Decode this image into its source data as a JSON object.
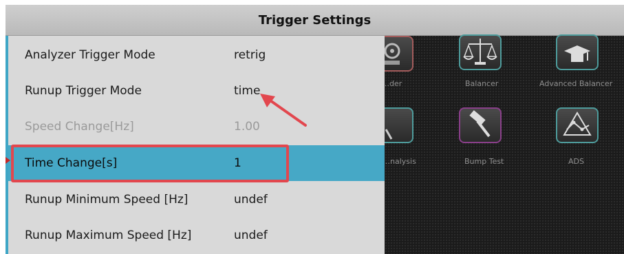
{
  "window": {
    "title": "Trigger Settings"
  },
  "settings": [
    {
      "label": "Analyzer Trigger Mode",
      "value": "retrig",
      "state": "normal"
    },
    {
      "label": "Runup Trigger Mode",
      "value": "time",
      "state": "normal"
    },
    {
      "label": "Speed Change[Hz]",
      "value": "1.00",
      "state": "disabled"
    },
    {
      "label": "Time Change[s]",
      "value": "1",
      "state": "selected"
    },
    {
      "label": "Runup Minimum Speed [Hz]",
      "value": "undef",
      "state": "normal"
    },
    {
      "label": "Runup Maximum Speed [Hz]",
      "value": "undef",
      "state": "normal"
    }
  ],
  "apps": {
    "row1": [
      {
        "label": "…der",
        "icon": "recorder-icon"
      },
      {
        "label": "Balancer",
        "icon": "balance-scale-icon"
      },
      {
        "label": "Advanced Balancer",
        "icon": "graduation-scale-icon"
      }
    ],
    "row2": [
      {
        "label": "…nalysis",
        "icon": "analysis-icon"
      },
      {
        "label": "Bump Test",
        "icon": "hammer-icon"
      },
      {
        "label": "ADS",
        "icon": "ads-graph-icon"
      }
    ]
  },
  "annotations": {
    "arrow_color": "#e2474e",
    "box_color": "#e2474e"
  },
  "colors": {
    "accent": "#46a8c6",
    "menu_bg": "#d9d9d9",
    "disabled_text": "#9a9a9a"
  }
}
